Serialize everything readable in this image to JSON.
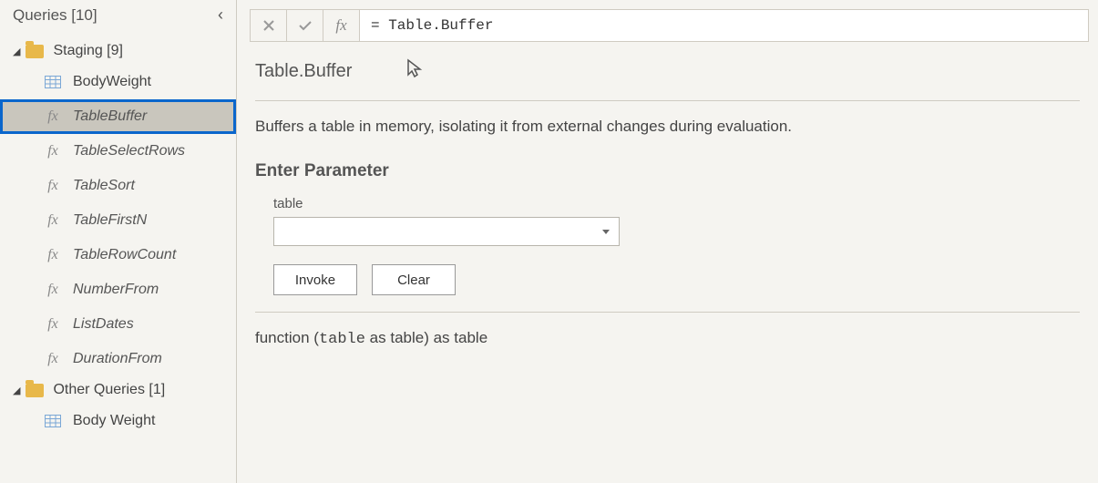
{
  "sidebar": {
    "title": "Queries [10]",
    "groups": [
      {
        "label": "Staging [9]",
        "items": [
          {
            "label": "BodyWeight",
            "kind": "table",
            "selected": false
          },
          {
            "label": "TableBuffer",
            "kind": "fx",
            "selected": true
          },
          {
            "label": "TableSelectRows",
            "kind": "fx",
            "selected": false
          },
          {
            "label": "TableSort",
            "kind": "fx",
            "selected": false
          },
          {
            "label": "TableFirstN",
            "kind": "fx",
            "selected": false
          },
          {
            "label": "TableRowCount",
            "kind": "fx",
            "selected": false
          },
          {
            "label": "NumberFrom",
            "kind": "fx",
            "selected": false
          },
          {
            "label": "ListDates",
            "kind": "fx",
            "selected": false
          },
          {
            "label": "DurationFrom",
            "kind": "fx",
            "selected": false
          }
        ]
      },
      {
        "label": "Other Queries [1]",
        "items": [
          {
            "label": "Body Weight",
            "kind": "table",
            "selected": false
          }
        ]
      }
    ]
  },
  "formula_bar": {
    "value": "= Table.Buffer"
  },
  "function": {
    "name": "Table.Buffer",
    "description": "Buffers a table in memory, isolating it from external changes during evaluation.",
    "param_section_title": "Enter Parameter",
    "param_label": "table",
    "invoke_label": "Invoke",
    "clear_label": "Clear",
    "signature_prefix": "function (",
    "signature_arg": "table",
    "signature_mid": " as table) as table"
  }
}
